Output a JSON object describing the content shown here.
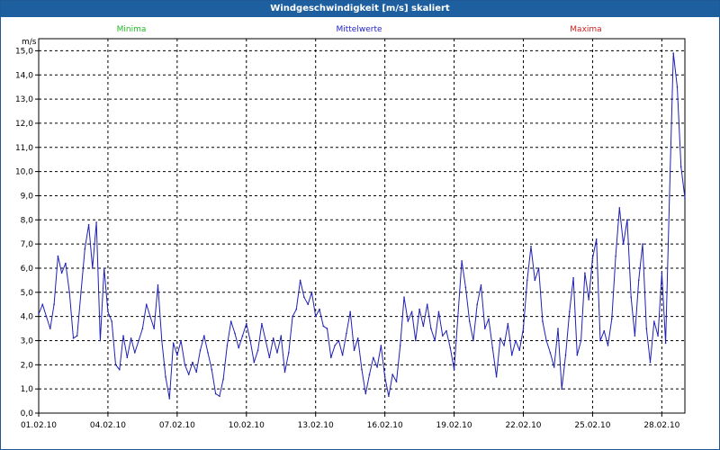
{
  "window": {
    "title": "Windgeschwindigkeit [m/s] skaliert"
  },
  "legend": [
    {
      "label": "Minima",
      "color": "#22bb22"
    },
    {
      "label": "Mittelwerte",
      "color": "#2222cc"
    },
    {
      "label": "Maxima",
      "color": "#cc2222"
    }
  ],
  "colors": {
    "titlebar": "#1e5f9f",
    "series": "#1f1fb4",
    "grid": "#000000"
  },
  "chart_data": {
    "type": "line",
    "title": "Windgeschwindigkeit [m/s] skaliert",
    "ylabel": "m/s",
    "xlabel": "",
    "xlim": [
      "2010-02-01",
      "2010-03-01"
    ],
    "ylim": [
      0,
      15.5
    ],
    "grid": true,
    "legend_position": "top",
    "x_tick_labels": [
      "01.02.10",
      "04.02.10",
      "07.02.10",
      "10.02.10",
      "13.02.10",
      "16.02.10",
      "19.02.10",
      "22.02.10",
      "25.02.10",
      "28.02.10"
    ],
    "y_tick_labels": [
      "0,0",
      "1,0",
      "2,0",
      "3,0",
      "4,0",
      "5,0",
      "6,0",
      "7,0",
      "8,0",
      "9,0",
      "10,0",
      "11,0",
      "12,0",
      "13,0",
      "14,0",
      "15,0"
    ],
    "series": [
      {
        "name": "Mittelwerte",
        "color": "#1f1fb4",
        "points": [
          [
            "01.02.10 00:00",
            4.1
          ],
          [
            "01.02.10 04:00",
            4.5
          ],
          [
            "01.02.10 08:00",
            4.0
          ],
          [
            "01.02.10 12:00",
            3.5
          ],
          [
            "01.02.10 16:00",
            4.5
          ],
          [
            "01.02.10 20:00",
            6.5
          ],
          [
            "02.02.10 00:00",
            5.8
          ],
          [
            "02.02.10 04:00",
            6.2
          ],
          [
            "02.02.10 08:00",
            5.0
          ],
          [
            "02.02.10 12:00",
            3.1
          ],
          [
            "02.02.10 16:00",
            3.2
          ],
          [
            "02.02.10 20:00",
            5.0
          ],
          [
            "03.02.10 00:00",
            6.8
          ],
          [
            "03.02.10 04:00",
            7.8
          ],
          [
            "03.02.10 08:00",
            6.0
          ],
          [
            "03.02.10 12:00",
            7.9
          ],
          [
            "03.02.10 16:00",
            3.0
          ],
          [
            "03.02.10 20:00",
            6.0
          ],
          [
            "04.02.10 00:00",
            4.2
          ],
          [
            "04.02.10 04:00",
            3.8
          ],
          [
            "04.02.10 08:00",
            2.0
          ],
          [
            "04.02.10 12:00",
            1.8
          ],
          [
            "04.02.10 16:00",
            3.2
          ],
          [
            "04.02.10 20:00",
            2.3
          ],
          [
            "05.02.10 00:00",
            3.1
          ],
          [
            "05.02.10 04:00",
            2.5
          ],
          [
            "05.02.10 08:00",
            3.0
          ],
          [
            "05.02.10 12:00",
            3.5
          ],
          [
            "05.02.10 16:00",
            4.5
          ],
          [
            "05.02.10 20:00",
            4.0
          ],
          [
            "06.02.10 00:00",
            3.5
          ],
          [
            "06.02.10 04:00",
            5.3
          ],
          [
            "06.02.10 08:00",
            3.0
          ],
          [
            "06.02.10 12:00",
            1.5
          ],
          [
            "06.02.10 16:00",
            0.6
          ],
          [
            "06.02.10 20:00",
            2.9
          ],
          [
            "07.02.10 00:00",
            2.4
          ],
          [
            "07.02.10 04:00",
            3.0
          ],
          [
            "07.02.10 08:00",
            2.0
          ],
          [
            "07.02.10 12:00",
            1.6
          ],
          [
            "07.02.10 16:00",
            2.1
          ],
          [
            "07.02.10 20:00",
            1.7
          ],
          [
            "08.02.10 00:00",
            2.6
          ],
          [
            "08.02.10 04:00",
            3.2
          ],
          [
            "08.02.10 08:00",
            2.5
          ],
          [
            "08.02.10 12:00",
            1.8
          ],
          [
            "08.02.10 16:00",
            0.8
          ],
          [
            "08.02.10 20:00",
            0.7
          ],
          [
            "09.02.10 00:00",
            1.4
          ],
          [
            "09.02.10 04:00",
            2.8
          ],
          [
            "09.02.10 08:00",
            3.8
          ],
          [
            "09.02.10 12:00",
            3.3
          ],
          [
            "09.02.10 16:00",
            2.7
          ],
          [
            "09.02.10 20:00",
            3.2
          ],
          [
            "10.02.10 00:00",
            3.7
          ],
          [
            "10.02.10 04:00",
            3.0
          ],
          [
            "10.02.10 08:00",
            2.1
          ],
          [
            "10.02.10 12:00",
            2.6
          ],
          [
            "10.02.10 16:00",
            3.7
          ],
          [
            "10.02.10 20:00",
            3.0
          ],
          [
            "11.02.10 00:00",
            2.3
          ],
          [
            "11.02.10 04:00",
            3.1
          ],
          [
            "11.02.10 08:00",
            2.5
          ],
          [
            "11.02.10 12:00",
            3.2
          ],
          [
            "11.02.10 16:00",
            1.7
          ],
          [
            "11.02.10 20:00",
            2.5
          ],
          [
            "12.02.10 00:00",
            4.0
          ],
          [
            "12.02.10 04:00",
            4.3
          ],
          [
            "12.02.10 08:00",
            5.5
          ],
          [
            "12.02.10 12:00",
            4.8
          ],
          [
            "12.02.10 16:00",
            4.5
          ],
          [
            "12.02.10 20:00",
            5.0
          ],
          [
            "13.02.10 00:00",
            4.0
          ],
          [
            "13.02.10 04:00",
            4.3
          ],
          [
            "13.02.10 08:00",
            3.6
          ],
          [
            "13.02.10 12:00",
            3.5
          ],
          [
            "13.02.10 16:00",
            2.3
          ],
          [
            "13.02.10 20:00",
            2.8
          ],
          [
            "14.02.10 00:00",
            3.0
          ],
          [
            "14.02.10 04:00",
            2.4
          ],
          [
            "14.02.10 08:00",
            3.3
          ],
          [
            "14.02.10 12:00",
            4.2
          ],
          [
            "14.02.10 16:00",
            2.6
          ],
          [
            "14.02.10 20:00",
            3.1
          ],
          [
            "15.02.10 00:00",
            1.8
          ],
          [
            "15.02.10 04:00",
            0.8
          ],
          [
            "15.02.10 08:00",
            1.6
          ],
          [
            "15.02.10 12:00",
            2.3
          ],
          [
            "15.02.10 16:00",
            1.9
          ],
          [
            "15.02.10 20:00",
            2.8
          ],
          [
            "16.02.10 00:00",
            1.5
          ],
          [
            "16.02.10 04:00",
            0.7
          ],
          [
            "16.02.10 08:00",
            1.6
          ],
          [
            "16.02.10 12:00",
            1.3
          ],
          [
            "16.02.10 16:00",
            2.8
          ],
          [
            "16.02.10 20:00",
            4.8
          ],
          [
            "17.02.10 00:00",
            3.8
          ],
          [
            "17.02.10 04:00",
            4.2
          ],
          [
            "17.02.10 08:00",
            3.0
          ],
          [
            "17.02.10 12:00",
            4.3
          ],
          [
            "17.02.10 16:00",
            3.6
          ],
          [
            "17.02.10 20:00",
            4.5
          ],
          [
            "18.02.10 00:00",
            3.5
          ],
          [
            "18.02.10 04:00",
            3.0
          ],
          [
            "18.02.10 08:00",
            4.2
          ],
          [
            "18.02.10 12:00",
            3.2
          ],
          [
            "18.02.10 16:00",
            3.4
          ],
          [
            "18.02.10 20:00",
            2.7
          ],
          [
            "19.02.10 00:00",
            1.8
          ],
          [
            "19.02.10 04:00",
            4.0
          ],
          [
            "19.02.10 08:00",
            6.3
          ],
          [
            "19.02.10 12:00",
            5.2
          ],
          [
            "19.02.10 16:00",
            3.8
          ],
          [
            "19.02.10 20:00",
            3.0
          ],
          [
            "20.02.10 00:00",
            4.5
          ],
          [
            "20.02.10 04:00",
            5.3
          ],
          [
            "20.02.10 08:00",
            3.5
          ],
          [
            "20.02.10 12:00",
            3.9
          ],
          [
            "20.02.10 16:00",
            2.7
          ],
          [
            "20.02.10 20:00",
            1.5
          ],
          [
            "21.02.10 00:00",
            3.1
          ],
          [
            "21.02.10 04:00",
            2.8
          ],
          [
            "21.02.10 08:00",
            3.7
          ],
          [
            "21.02.10 12:00",
            2.4
          ],
          [
            "21.02.10 16:00",
            3.0
          ],
          [
            "21.02.10 20:00",
            2.6
          ],
          [
            "22.02.10 00:00",
            3.5
          ],
          [
            "22.02.10 04:00",
            5.5
          ],
          [
            "22.02.10 08:00",
            6.9
          ],
          [
            "22.02.10 12:00",
            5.5
          ],
          [
            "22.02.10 16:00",
            6.0
          ],
          [
            "22.02.10 20:00",
            3.8
          ],
          [
            "23.02.10 00:00",
            3.0
          ],
          [
            "23.02.10 04:00",
            2.5
          ],
          [
            "23.02.10 08:00",
            1.9
          ],
          [
            "23.02.10 12:00",
            3.5
          ],
          [
            "23.02.10 16:00",
            1.0
          ],
          [
            "23.02.10 20:00",
            2.4
          ],
          [
            "24.02.10 00:00",
            4.2
          ],
          [
            "24.02.10 04:00",
            5.6
          ],
          [
            "24.02.10 08:00",
            2.4
          ],
          [
            "24.02.10 12:00",
            3.0
          ],
          [
            "24.02.10 16:00",
            5.8
          ],
          [
            "24.02.10 20:00",
            4.7
          ],
          [
            "25.02.10 00:00",
            6.4
          ],
          [
            "25.02.10 04:00",
            7.2
          ],
          [
            "25.02.10 08:00",
            3.0
          ],
          [
            "25.02.10 12:00",
            3.4
          ],
          [
            "25.02.10 16:00",
            2.8
          ],
          [
            "25.02.10 20:00",
            3.9
          ],
          [
            "26.02.10 00:00",
            6.5
          ],
          [
            "26.02.10 04:00",
            8.5
          ],
          [
            "26.02.10 08:00",
            7.0
          ],
          [
            "26.02.10 12:00",
            8.0
          ],
          [
            "26.02.10 16:00",
            4.8
          ],
          [
            "26.02.10 20:00",
            3.2
          ],
          [
            "27.02.10 00:00",
            5.5
          ],
          [
            "27.02.10 04:00",
            7.0
          ],
          [
            "27.02.10 08:00",
            3.5
          ],
          [
            "27.02.10 12:00",
            2.1
          ],
          [
            "27.02.10 16:00",
            3.8
          ],
          [
            "27.02.10 20:00",
            3.2
          ],
          [
            "28.02.10 00:00",
            5.8
          ],
          [
            "28.02.10 04:00",
            2.9
          ],
          [
            "28.02.10 08:00",
            9.0
          ],
          [
            "28.02.10 12:00",
            14.9
          ],
          [
            "28.02.10 16:00",
            13.5
          ],
          [
            "28.02.10 20:00",
            10.2
          ],
          [
            "01.03.10 00:00",
            8.9
          ]
        ]
      }
    ]
  }
}
